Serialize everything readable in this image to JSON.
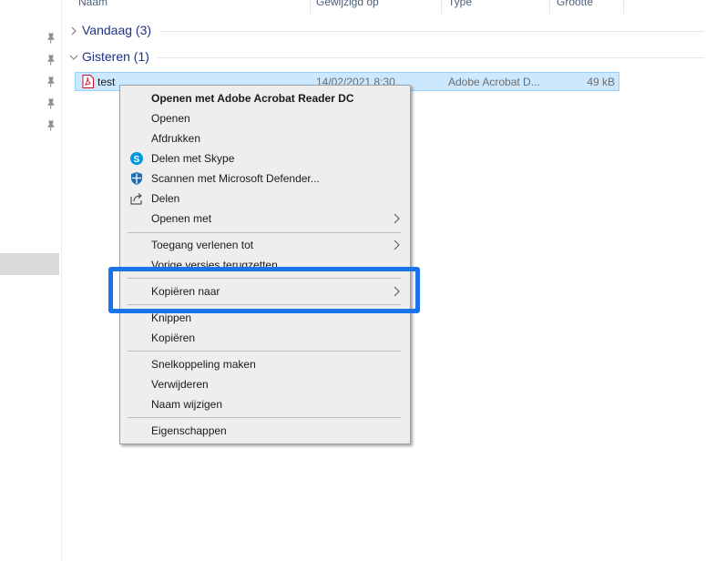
{
  "colors": {
    "accent": "#1a73e8",
    "selection": "#cce8ff",
    "group_title": "#1e3287"
  },
  "columns": {
    "name": "Naam",
    "modified": "Gewijzigd op",
    "type": "Type",
    "size": "Grootte"
  },
  "groups": {
    "today": "Vandaag (3)",
    "yesterday": "Gisteren (1)"
  },
  "file": {
    "icon": "pdf-icon",
    "name": "test",
    "date": "14/02/2021 8:30",
    "type": "Adobe Acrobat D...",
    "size": "49 kB"
  },
  "menu": {
    "items": [
      {
        "label": "Openen met Adobe Acrobat Reader DC"
      },
      {
        "label": "Openen"
      },
      {
        "label": "Afdrukken"
      },
      {
        "label": "Delen met Skype",
        "icon": "skype-icon"
      },
      {
        "label": "Scannen met Microsoft Defender...",
        "icon": "defender-icon"
      },
      {
        "label": "Delen",
        "icon": "share-icon"
      },
      {
        "label": "Openen met"
      },
      {
        "label": "Toegang verlenen tot"
      },
      {
        "label": "Vorige versies terugzetten"
      },
      {
        "label": "Kopiëren naar"
      },
      {
        "label": "Knippen"
      },
      {
        "label": "Kopiëren"
      },
      {
        "label": "Snelkoppeling maken"
      },
      {
        "label": "Verwijderen"
      },
      {
        "label": "Naam wijzigen"
      },
      {
        "label": "Eigenschappen"
      }
    ]
  }
}
